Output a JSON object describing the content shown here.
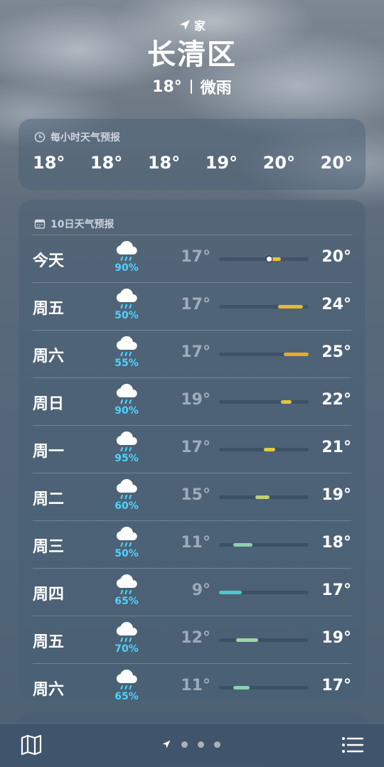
{
  "location": {
    "label": "家",
    "icon": "location-arrow-icon"
  },
  "city": "长清区",
  "current": {
    "temp": "18°",
    "condition": "微雨"
  },
  "hourly": {
    "title": "每小时天气预报",
    "icon": "clock-icon",
    "temps": [
      "18°",
      "18°",
      "18°",
      "19°",
      "20°",
      "20°"
    ]
  },
  "daily": {
    "title": "10日天气预报",
    "icon": "calendar-icon",
    "range": {
      "min": 9,
      "max": 25
    },
    "days": [
      {
        "day": "今天",
        "icon": "rain-cloud-icon",
        "pct": "90%",
        "lo": "17°",
        "hi": "20°",
        "bar_lo": 18,
        "bar_hi": 20,
        "bar_color": "#e8c43a",
        "current": 18
      },
      {
        "day": "周五",
        "icon": "rain-cloud-icon",
        "pct": "50%",
        "lo": "17°",
        "hi": "24°",
        "bar_lo": 19.5,
        "bar_hi": 24,
        "bar_color": "#e9b92e"
      },
      {
        "day": "周六",
        "icon": "rain-cloud-icon",
        "pct": "55%",
        "lo": "17°",
        "hi": "25°",
        "bar_lo": 20.5,
        "bar_hi": 25,
        "bar_color": "#eaa928"
      },
      {
        "day": "周日",
        "icon": "rain-cloud-icon",
        "pct": "90%",
        "lo": "19°",
        "hi": "22°",
        "bar_lo": 20,
        "bar_hi": 22,
        "bar_color": "#e6c538"
      },
      {
        "day": "周一",
        "icon": "rain-cloud-icon",
        "pct": "95%",
        "lo": "17°",
        "hi": "21°",
        "bar_lo": 17,
        "bar_hi": 19,
        "bar_color": "#e3cb3c"
      },
      {
        "day": "周二",
        "icon": "rain-cloud-icon",
        "pct": "60%",
        "lo": "15°",
        "hi": "19°",
        "bar_lo": 15.5,
        "bar_hi": 18,
        "bar_color": "#c4cf74"
      },
      {
        "day": "周三",
        "icon": "rain-cloud-icon",
        "pct": "50%",
        "lo": "11°",
        "hi": "18°",
        "bar_lo": 11.5,
        "bar_hi": 15,
        "bar_color": "#8fd0a8"
      },
      {
        "day": "周四",
        "icon": "rain-cloud-icon",
        "pct": "65%",
        "lo": "9°",
        "hi": "17°",
        "bar_lo": 9,
        "bar_hi": 13,
        "bar_color": "#4cc9d0"
      },
      {
        "day": "周五",
        "icon": "rain-cloud-icon",
        "pct": "70%",
        "lo": "12°",
        "hi": "19°",
        "bar_lo": 12,
        "bar_hi": 16,
        "bar_color": "#9ed8a2"
      },
      {
        "day": "周六",
        "icon": "rain-cloud-icon",
        "pct": "65%",
        "lo": "11°",
        "hi": "17°",
        "bar_lo": 11.5,
        "bar_hi": 14.5,
        "bar_color": "#86d4b0"
      }
    ]
  },
  "bottom_bar": {
    "map_icon": "map-icon",
    "list_icon": "list-icon",
    "pager_icon": "location-arrow-icon",
    "pages": 3
  }
}
